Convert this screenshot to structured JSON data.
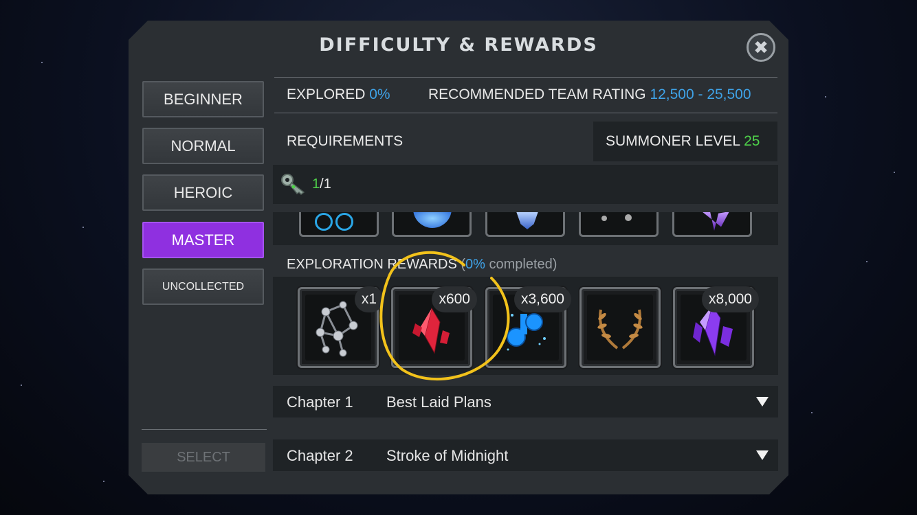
{
  "title": "DIFFICULTY & REWARDS",
  "close_icon_glyph": "✖",
  "difficulties": [
    {
      "label": "BEGINNER",
      "active": false
    },
    {
      "label": "NORMAL",
      "active": false
    },
    {
      "label": "HEROIC",
      "active": false
    },
    {
      "label": "MASTER",
      "active": true
    },
    {
      "label": "UNCOLLECTED",
      "active": false
    }
  ],
  "select_label": "SELECT",
  "explored": {
    "label": "EXPLORED",
    "value": "0%"
  },
  "team_rating": {
    "label": "RECOMMENDED TEAM RATING",
    "value": "12,500 - 25,500"
  },
  "requirements": {
    "label": "REQUIREMENTS",
    "summoner_label": "SUMMONER LEVEL",
    "summoner_value": "25",
    "key_have": "1",
    "key_sep": "/",
    "key_need": "1"
  },
  "exploration_rewards": {
    "label": "EXPLORATION REWARDS",
    "open_paren": "(",
    "percent": "0%",
    "completed": "completed)",
    "items": [
      {
        "icon": "iso-molecule-icon",
        "qty": "x1"
      },
      {
        "icon": "red-crystal-icon",
        "qty": "x600"
      },
      {
        "icon": "blue-potion-icon",
        "qty": "x3,600"
      },
      {
        "icon": "bronze-laurel-icon",
        "qty": ""
      },
      {
        "icon": "purple-crystal-icon",
        "qty": "x8,000"
      }
    ]
  },
  "chapters": [
    {
      "label": "Chapter 1",
      "name": "Best Laid Plans"
    },
    {
      "label": "Chapter 2",
      "name": "Stroke of Midnight"
    }
  ],
  "colors": {
    "accent_purple": "#8f30e0",
    "value_blue": "#3fa3e8",
    "value_green": "#4fd24a",
    "annotation_yellow": "#f2c21b"
  }
}
